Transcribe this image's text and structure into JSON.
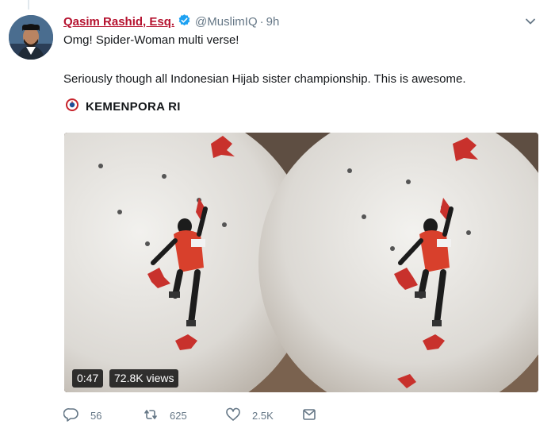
{
  "tweet": {
    "author_name": "Qasim Rashid, Esq.",
    "handle": "@MuslimIQ",
    "separator": "·",
    "time": "9h",
    "text_line1": "Omg! Spider-Woman multi verse!",
    "text_line2": "Seriously though all Indonesian Hijab sister championship. This is awesome.",
    "brand_color": "#b5122f",
    "verified_color": "#1da1f2"
  },
  "source": {
    "name": "KEMENPORA RI"
  },
  "video": {
    "duration": "0:47",
    "views": "72.8K views"
  },
  "actions": {
    "replies": "56",
    "retweets": "625",
    "likes": "2.5K"
  },
  "icons": [
    "avatar",
    "verified-icon",
    "chevron-down-icon",
    "kemenpora-logo-icon",
    "reply-icon",
    "retweet-icon",
    "like-icon",
    "message-icon"
  ]
}
